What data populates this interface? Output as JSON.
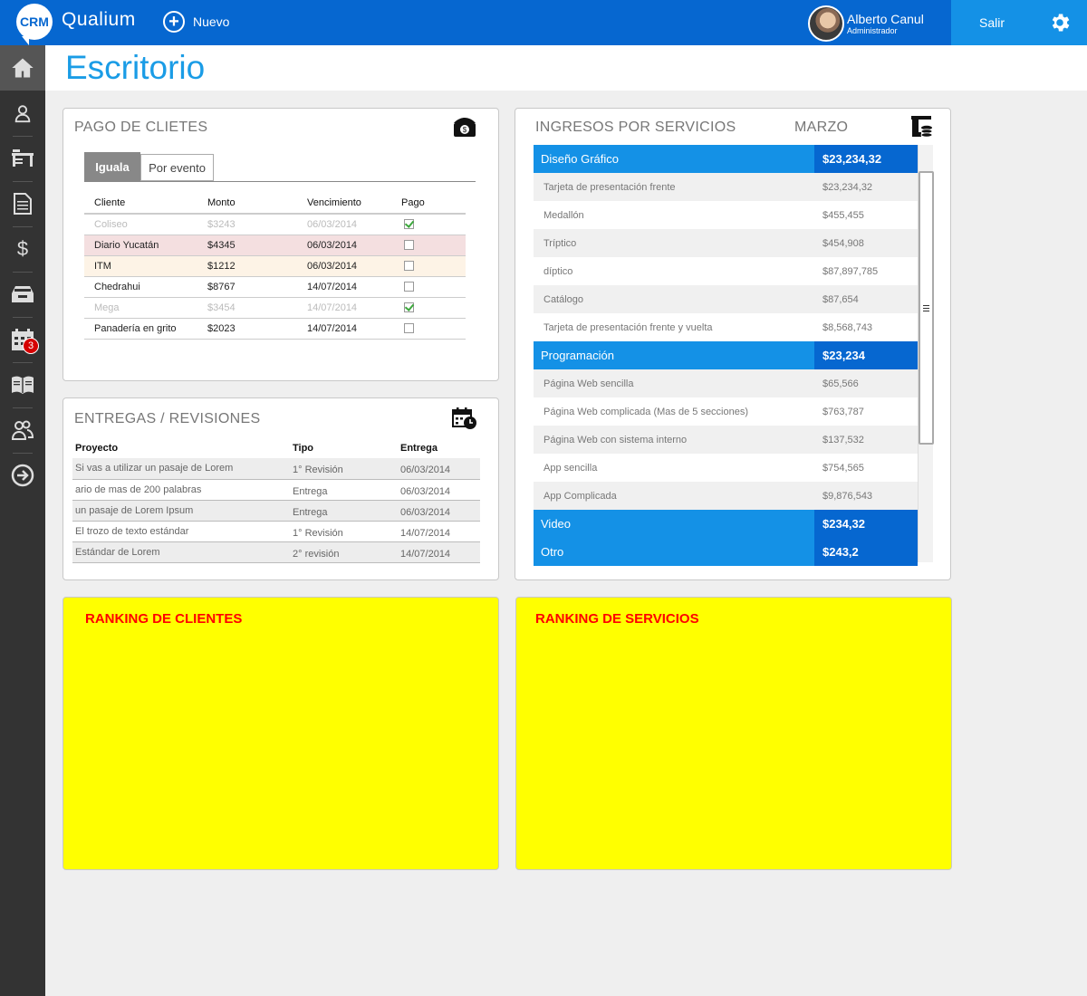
{
  "app": {
    "logo": "CRM",
    "name": "Qualium"
  },
  "topbar": {
    "new_label": "Nuevo",
    "user_name": "Alberto Canul",
    "user_role": "Administrador",
    "logout_label": "Salir"
  },
  "sidebar": {
    "items": [
      {
        "name": "home",
        "icon": "home-icon"
      },
      {
        "name": "clientes",
        "icon": "user-icon"
      },
      {
        "name": "escritorio",
        "icon": "desk-icon"
      },
      {
        "name": "documentos",
        "icon": "document-icon"
      },
      {
        "name": "pagos",
        "icon": "dollar-icon"
      },
      {
        "name": "bandeja",
        "icon": "inbox-icon"
      },
      {
        "name": "calendario",
        "icon": "calendar-icon",
        "badge": "3"
      },
      {
        "name": "catalogo",
        "icon": "book-icon"
      },
      {
        "name": "usuarios",
        "icon": "users-icon"
      },
      {
        "name": "salir",
        "icon": "logout-icon"
      }
    ]
  },
  "page": {
    "title": "Escritorio"
  },
  "pagos": {
    "title": "PAGO DE CLIETES",
    "tabs": [
      "Iguala",
      "Por evento"
    ],
    "headers": [
      "Cliente",
      "Monto",
      "Vencimiento",
      "Pago"
    ],
    "rows": [
      {
        "cliente": "Coliseo",
        "monto": "$3243",
        "vencimiento": "06/03/2014",
        "pagado": true,
        "style": "muted"
      },
      {
        "cliente": "Diario Yucatán",
        "monto": "$4345",
        "vencimiento": "06/03/2014",
        "pagado": false,
        "style": "pink"
      },
      {
        "cliente": "ITM",
        "monto": "$1212",
        "vencimiento": "06/03/2014",
        "pagado": false,
        "style": "cream"
      },
      {
        "cliente": "Chedrahui",
        "monto": "$8767",
        "vencimiento": "14/07/2014",
        "pagado": false,
        "style": ""
      },
      {
        "cliente": "Mega",
        "monto": "$3454",
        "vencimiento": "14/07/2014",
        "pagado": true,
        "style": "muted"
      },
      {
        "cliente": "Panadería en grito",
        "monto": "$2023",
        "vencimiento": "14/07/2014",
        "pagado": false,
        "style": ""
      }
    ]
  },
  "entregas": {
    "title": "ENTREGAS / REVISIONES",
    "headers": [
      "Proyecto",
      "Tipo",
      "Entrega"
    ],
    "rows": [
      {
        "proyecto": "Si vas a utilizar un pasaje de Lorem",
        "tipo": "1° Revisión",
        "entrega": "06/03/2014"
      },
      {
        "proyecto": "ario de mas de 200 palabras",
        "tipo": "Entrega",
        "entrega": "06/03/2014"
      },
      {
        "proyecto": "un pasaje de Lorem Ipsum",
        "tipo": "Entrega",
        "entrega": "06/03/2014"
      },
      {
        "proyecto": "El trozo de texto estándar",
        "tipo": "1° Revisión",
        "entrega": "14/07/2014"
      },
      {
        "proyecto": "Estándar de Lorem",
        "tipo": "2° revisión",
        "entrega": "14/07/2014"
      }
    ]
  },
  "ingresos": {
    "title": "INGRESOS POR SERVICIOS",
    "month": "MARZO",
    "categories": [
      {
        "name": "Diseño Gráfico",
        "amount": "$23,234,32",
        "items": [
          {
            "name": "Tarjeta de presentación frente",
            "amount": "$23,234,32"
          },
          {
            "name": "Medallón",
            "amount": "$455,455"
          },
          {
            "name": "Tríptico",
            "amount": "$454,908"
          },
          {
            "name": "díptico",
            "amount": "$87,897,785"
          },
          {
            "name": "Catálogo",
            "amount": "$87,654"
          },
          {
            "name": "Tarjeta de presentación frente y vuelta",
            "amount": "$8,568,743"
          }
        ]
      },
      {
        "name": "Programación",
        "amount": "$23,234",
        "items": [
          {
            "name": "Página Web sencilla",
            "amount": "$65,566"
          },
          {
            "name": "Página Web complicada (Mas de 5 secciones)",
            "amount": "$763,787"
          },
          {
            "name": "Página Web con sistema interno",
            "amount": "$137,532"
          },
          {
            "name": "App sencilla",
            "amount": "$754,565"
          },
          {
            "name": "App Complicada",
            "amount": "$9,876,543"
          }
        ]
      },
      {
        "name": "Video",
        "amount": "$234,32",
        "items": []
      },
      {
        "name": "Otro",
        "amount": "$243,2",
        "items": []
      }
    ]
  },
  "ranking": {
    "clientes_title": "RANKING DE CLIENTES",
    "servicios_title": "RANKING DE SERVICIOS"
  },
  "colors": {
    "primary": "#0667d0",
    "accent": "#1491e6",
    "title": "#1a9ce6",
    "sidebar": "#333333",
    "ranking_bg": "#ffff00",
    "ranking_text": "#ff0000"
  }
}
